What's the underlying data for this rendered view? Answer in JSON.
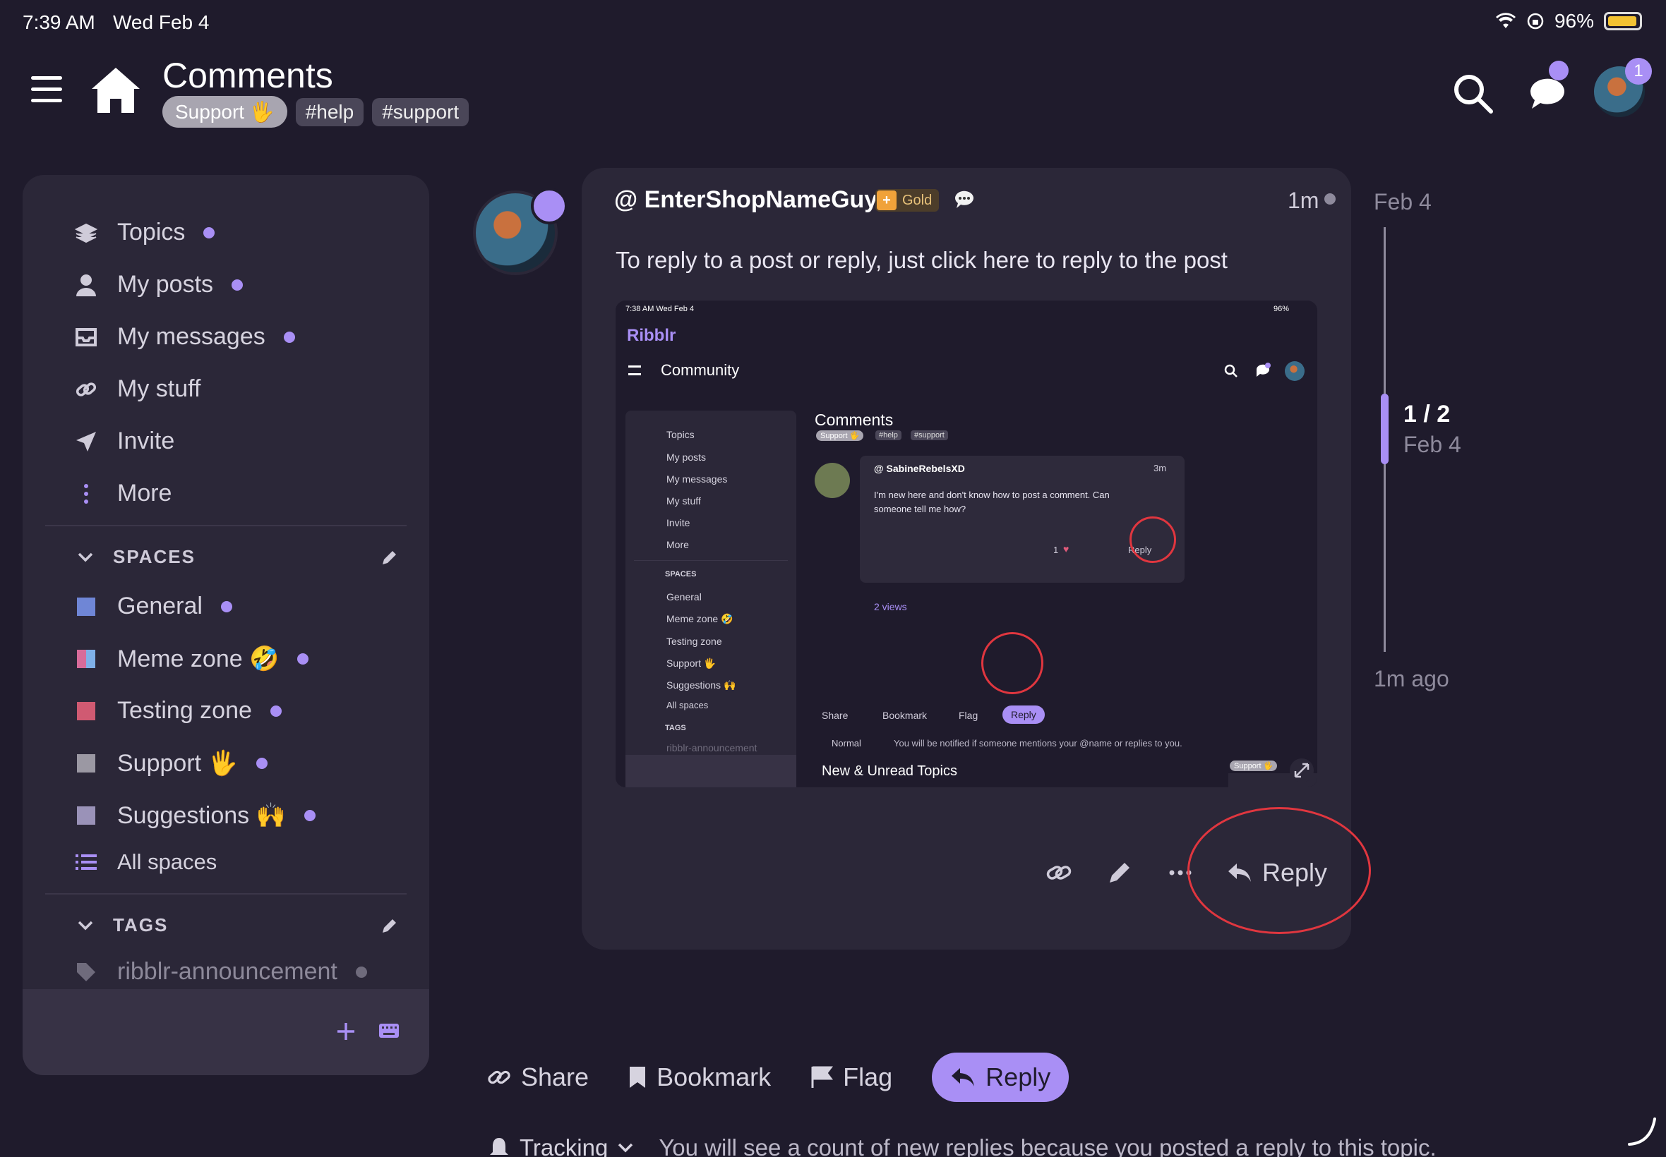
{
  "status_bar": {
    "time": "7:39 AM",
    "date": "Wed Feb 4",
    "battery": "96%"
  },
  "header": {
    "title": "Comments",
    "category": "Support 🖐",
    "tags": [
      "#help",
      "#support"
    ],
    "messages_badge": "",
    "avatar_badge": "1"
  },
  "sidebar": {
    "items": [
      {
        "label": "Topics",
        "icon": "layers-icon"
      },
      {
        "label": "My posts",
        "icon": "user-icon"
      },
      {
        "label": "My messages",
        "icon": "inbox-icon"
      },
      {
        "label": "My stuff",
        "icon": "link-icon"
      },
      {
        "label": "Invite",
        "icon": "paper-plane-icon"
      },
      {
        "label": "More",
        "icon": "more-vertical-icon"
      }
    ],
    "spaces_header": "SPACES",
    "spaces": [
      {
        "label": "General",
        "color": "#6f86d6"
      },
      {
        "label": "Meme zone 🤣",
        "color": "#d86b9a"
      },
      {
        "label": "Testing zone",
        "color": "#d05a72"
      },
      {
        "label": "Support 🖐",
        "color": "#9b98a3"
      },
      {
        "label": "Suggestions 🙌",
        "color": "#9a92b8"
      }
    ],
    "all_spaces": "All spaces",
    "tags_header": "TAGS",
    "tags": [
      {
        "label": "ribblr-announcement"
      }
    ]
  },
  "post": {
    "author": "@ EnterShopNameGuy",
    "badge": "Gold",
    "time": "1m",
    "text": "To reply to a post or reply, just click here to reply to the post",
    "reply_label": "Reply"
  },
  "embedded": {
    "time": "7:38 AM   Wed Feb 4",
    "battery": "96%",
    "brand": "Ribblr",
    "nav_title": "Community",
    "page_title": "Comments",
    "category": "Support 🖐",
    "tags": [
      "#help",
      "#support"
    ],
    "sidebar": [
      "Topics",
      "My posts",
      "My messages",
      "My stuff",
      "Invite",
      "More"
    ],
    "spaces_header": "SPACES",
    "spaces": [
      "General",
      "Meme zone 🤣",
      "Testing zone",
      "Support 🖐",
      "Suggestions 🙌"
    ],
    "all_spaces": "All spaces",
    "tags_header": "TAGS",
    "tag": "ribblr-announcement",
    "comment_author": "@ SabineRebelsXD",
    "comment_time": "3m",
    "comment_text_1": "I'm new here and don't know how to post a comment. Can",
    "comment_text_2": "someone tell me how?",
    "likes": "1",
    "reply": "Reply",
    "views": "2 views",
    "share": "Share",
    "bookmark": "Bookmark",
    "flag": "Flag",
    "notify_level": "Normal",
    "notify_text": "You will be notified if someone mentions your @name or replies to you.",
    "section": "New & Unread Topics",
    "topic_tag": "Support 🖐"
  },
  "timeline": {
    "date_top": "Feb 4",
    "count": "1 / 2",
    "date_mid": "Feb 4",
    "ago": "1m ago"
  },
  "bottom": {
    "share": "Share",
    "bookmark": "Bookmark",
    "flag": "Flag",
    "reply": "Reply",
    "tracking": "Tracking",
    "tracking_text": "You will see a count of new replies because you posted a reply to this topic."
  },
  "colors": {
    "accent": "#a98ff5",
    "background": "#1f1b2c",
    "card": "#2b2738",
    "annotation": "#e0363f"
  }
}
